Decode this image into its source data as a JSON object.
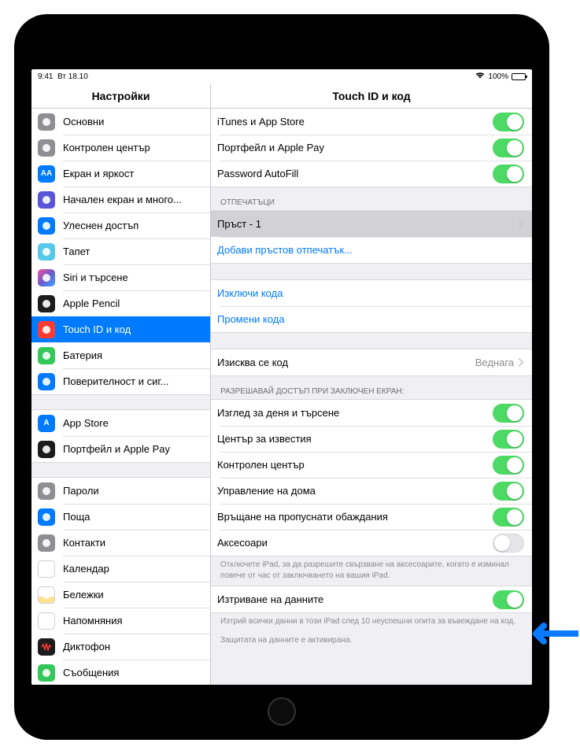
{
  "status": {
    "time": "9:41",
    "date": "Вт 18.10",
    "battery": "100%"
  },
  "nav": {
    "left_title": "Настройки",
    "right_title": "Touch ID и код"
  },
  "sidebar": {
    "groups": [
      {
        "items": [
          {
            "id": "general",
            "label": "Основни",
            "icon": "gear-icon",
            "icon_bg": "ic-gray"
          },
          {
            "id": "control-center",
            "label": "Контролен център",
            "icon": "switches-icon",
            "icon_bg": "ic-gray"
          },
          {
            "id": "display",
            "label": "Екран и яркост",
            "icon": "aa-icon",
            "icon_bg": "ic-blue",
            "glyph": "AA"
          },
          {
            "id": "home-screen",
            "label": "Начален екран и много...",
            "icon": "grid-icon",
            "icon_bg": "ic-indigo"
          },
          {
            "id": "accessibility",
            "label": "Улеснен достъп",
            "icon": "person-icon",
            "icon_bg": "ic-blue"
          },
          {
            "id": "wallpaper",
            "label": "Тапет",
            "icon": "flower-icon",
            "icon_bg": "ic-blue",
            "style": "cyan"
          },
          {
            "id": "siri",
            "label": "Siri и търсене",
            "icon": "siri-icon",
            "icon_bg": "ic-gradient"
          },
          {
            "id": "apple-pencil",
            "label": "Apple Pencil",
            "icon": "pencil-icon",
            "icon_bg": "ic-black"
          },
          {
            "id": "touch-id",
            "label": "Touch ID и код",
            "icon": "fingerprint-icon",
            "icon_bg": "ic-red",
            "selected": true
          },
          {
            "id": "battery",
            "label": "Батерия",
            "icon": "battery-icon",
            "icon_bg": "ic-green"
          },
          {
            "id": "privacy",
            "label": "Поверителност и сиг...",
            "icon": "hand-icon",
            "icon_bg": "ic-blue"
          }
        ]
      },
      {
        "items": [
          {
            "id": "app-store",
            "label": "App Store",
            "icon": "appstore-icon",
            "icon_bg": "ic-blue",
            "glyph": "A"
          },
          {
            "id": "wallet",
            "label": "Портфейл и Apple Pay",
            "icon": "wallet-icon",
            "icon_bg": "ic-black"
          }
        ]
      },
      {
        "items": [
          {
            "id": "passwords",
            "label": "Пароли",
            "icon": "key-icon",
            "icon_bg": "ic-gray"
          },
          {
            "id": "mail",
            "label": "Поща",
            "icon": "mail-icon",
            "icon_bg": "ic-blue"
          },
          {
            "id": "contacts",
            "label": "Контакти",
            "icon": "contacts-icon",
            "icon_bg": "ic-gray"
          },
          {
            "id": "calendar",
            "label": "Календар",
            "icon": "calendar-icon",
            "icon_bg": "ic-white"
          },
          {
            "id": "notes",
            "label": "Бележки",
            "icon": "notes-icon",
            "icon_bg": "ic-white",
            "style": "yellow"
          },
          {
            "id": "reminders",
            "label": "Напомняния",
            "icon": "reminders-icon",
            "icon_bg": "ic-white"
          },
          {
            "id": "voice-memos",
            "label": "Диктофон",
            "icon": "waveform-icon",
            "icon_bg": "ic-black",
            "style": "redwave"
          },
          {
            "id": "messages",
            "label": "Съобщения",
            "icon": "message-icon",
            "icon_bg": "ic-green"
          }
        ]
      }
    ]
  },
  "detail": {
    "use_for": {
      "items": [
        {
          "id": "itunes",
          "label": "iTunes и App Store",
          "on": true
        },
        {
          "id": "wallet-pay",
          "label": "Портфейл и Apple Pay",
          "on": true
        },
        {
          "id": "autofill",
          "label": "Password AutoFill",
          "on": true
        }
      ]
    },
    "fingerprints": {
      "header": "ОТПЕЧАТЪЦИ",
      "finger_label": "Пръст - 1",
      "add_label": "Добави пръстов отпечатък..."
    },
    "passcode_actions": {
      "turn_off": "Изключи кода",
      "change": "Промени кода"
    },
    "require": {
      "label": "Изисква се код",
      "value": "Веднага"
    },
    "allow_locked": {
      "header": "РАЗРЕШАВАЙ ДОСТЪП ПРИ ЗАКЛЮЧЕН ЕКРАН:",
      "items": [
        {
          "id": "today",
          "label": "Изглед за деня и търсене",
          "on": true
        },
        {
          "id": "notif",
          "label": "Център за известия",
          "on": true
        },
        {
          "id": "cc",
          "label": "Контролен център",
          "on": true
        },
        {
          "id": "home-ctrl",
          "label": "Управление на дома",
          "on": true
        },
        {
          "id": "missed",
          "label": "Връщане на пропуснати обаждания",
          "on": true
        },
        {
          "id": "accessories",
          "label": "Аксесоари",
          "on": false
        }
      ],
      "footer": "Отключете iPad, за да разрешите свързване на аксесоарите, когато е изминал повече от час от заключването на вашия iPad."
    },
    "erase": {
      "label": "Изтриване на данните",
      "on": true,
      "footer1": "Изтрий всички данни в този iPad след 10 неуспешни опита за въвеждане на код.",
      "footer2": "Защитата на данните е активирана."
    }
  }
}
